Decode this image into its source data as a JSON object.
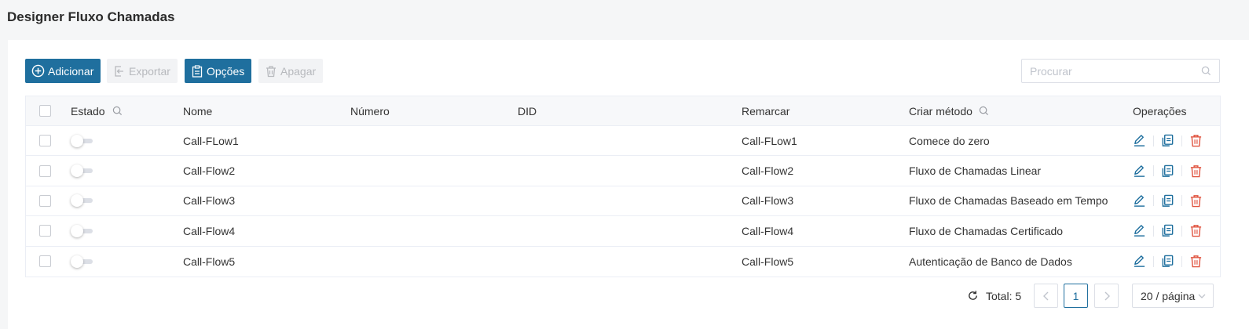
{
  "page": {
    "title": "Designer Fluxo Chamadas"
  },
  "toolbar": {
    "add_label": "Adicionar",
    "export_label": "Exportar",
    "options_label": "Opções",
    "delete_label": "Apagar"
  },
  "search": {
    "placeholder": "Procurar"
  },
  "table": {
    "columns": {
      "status": "Estado",
      "name": "Nome",
      "number": "Número",
      "did": "DID",
      "redial": "Remarcar",
      "method": "Criar método",
      "operations": "Operações"
    },
    "rows": [
      {
        "name": "Call-FLow1",
        "number": "",
        "did": "",
        "redial": "Call-FLow1",
        "method": "Comece do zero",
        "enabled": false
      },
      {
        "name": "Call-Flow2",
        "number": "",
        "did": "",
        "redial": "Call-Flow2",
        "method": "Fluxo de Chamadas Linear",
        "enabled": false
      },
      {
        "name": "Call-Flow3",
        "number": "",
        "did": "",
        "redial": "Call-Flow3",
        "method": "Fluxo de Chamadas Baseado em Tempo",
        "enabled": false
      },
      {
        "name": "Call-Flow4",
        "number": "",
        "did": "",
        "redial": "Call-Flow4",
        "method": "Fluxo de Chamadas Certificado",
        "enabled": false
      },
      {
        "name": "Call-Flow5",
        "number": "",
        "did": "",
        "redial": "Call-Flow5",
        "method": "Autenticação de Banco de Dados",
        "enabled": false
      }
    ]
  },
  "pagination": {
    "total_label": "Total: 5",
    "current_page": "1",
    "page_size": "20 / página"
  },
  "colors": {
    "primary": "#1f6f9e",
    "danger": "#e0533f",
    "edit_icon": "#1f6f9e"
  },
  "icons": {
    "add": "plus-circle-icon",
    "export": "export-icon",
    "options": "clipboard-icon",
    "delete": "trash-icon",
    "search": "search-icon",
    "edit": "pencil-icon",
    "copy": "copy-icon",
    "remove": "trash-icon",
    "refresh": "refresh-icon",
    "prev": "chevron-left-icon",
    "next": "chevron-right-icon",
    "dropdown": "chevron-down-icon"
  }
}
